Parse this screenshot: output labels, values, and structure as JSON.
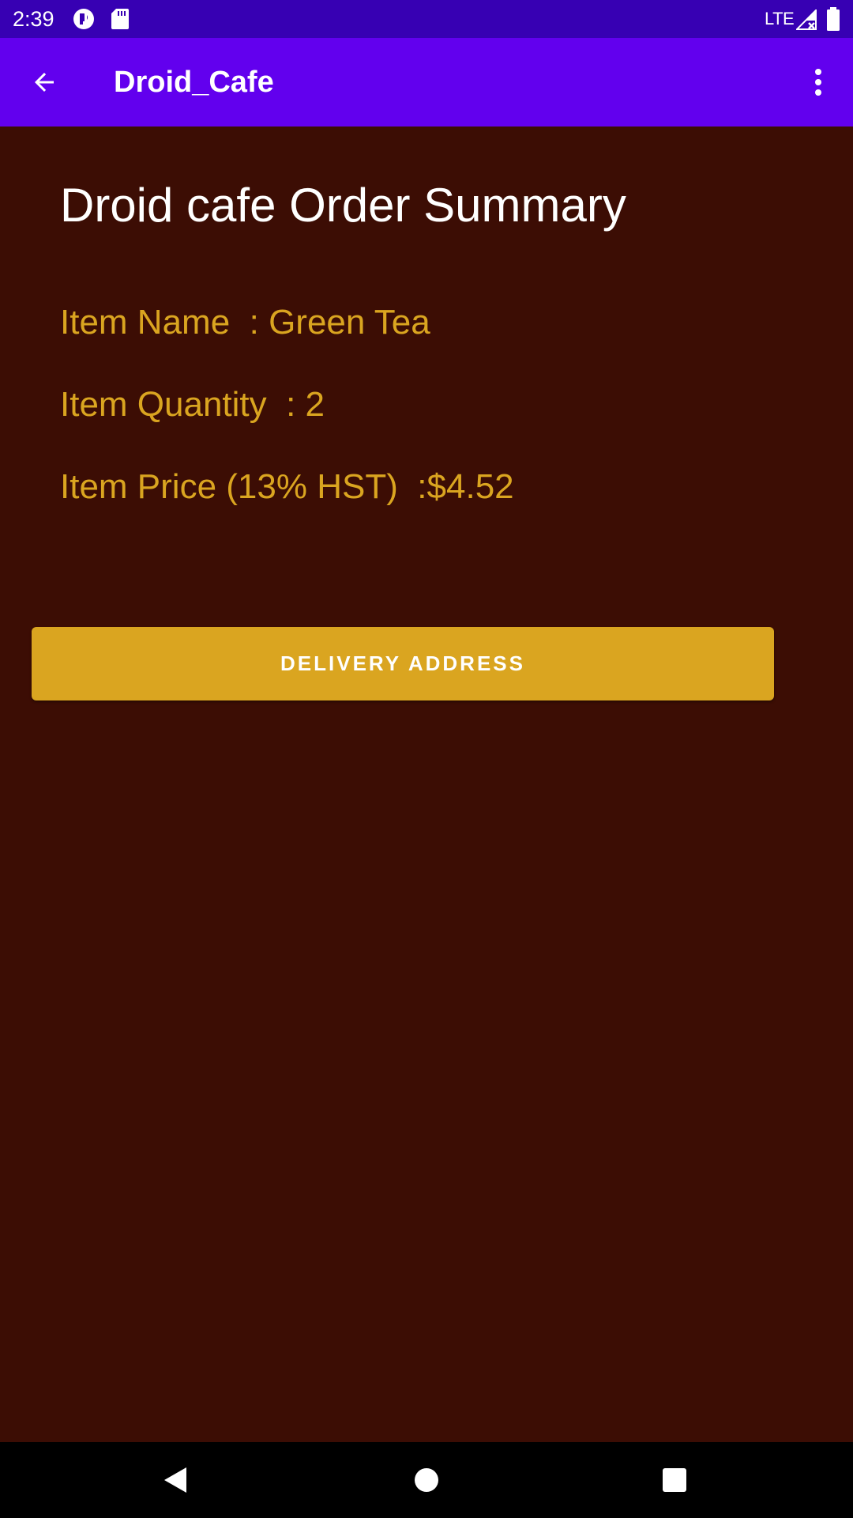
{
  "status_bar": {
    "time": "2:39",
    "network": "LTE",
    "icons": [
      "notification-app-icon",
      "sd-card-icon",
      "signal-icon",
      "battery-icon"
    ]
  },
  "app_bar": {
    "title": "Droid_Cafe",
    "back_icon": "arrow-back-icon",
    "menu_icon": "more-vert-icon"
  },
  "summary": {
    "title": "Droid cafe Order Summary",
    "item_name": "Item Name  : Green Tea",
    "item_quantity": "Item Quantity  : 2",
    "item_price": "Item Price (13% HST)  :$4.52"
  },
  "actions": {
    "delivery_button": "DELIVERY ADDRESS"
  },
  "nav_bar": {
    "icons": [
      "back-triangle-icon",
      "home-circle-icon",
      "recents-square-icon"
    ]
  },
  "colors": {
    "status_bar": "#3700b3",
    "app_bar": "#6200ee",
    "background": "#3c0d04",
    "accent": "#daa520",
    "title_text": "#ffffff"
  }
}
